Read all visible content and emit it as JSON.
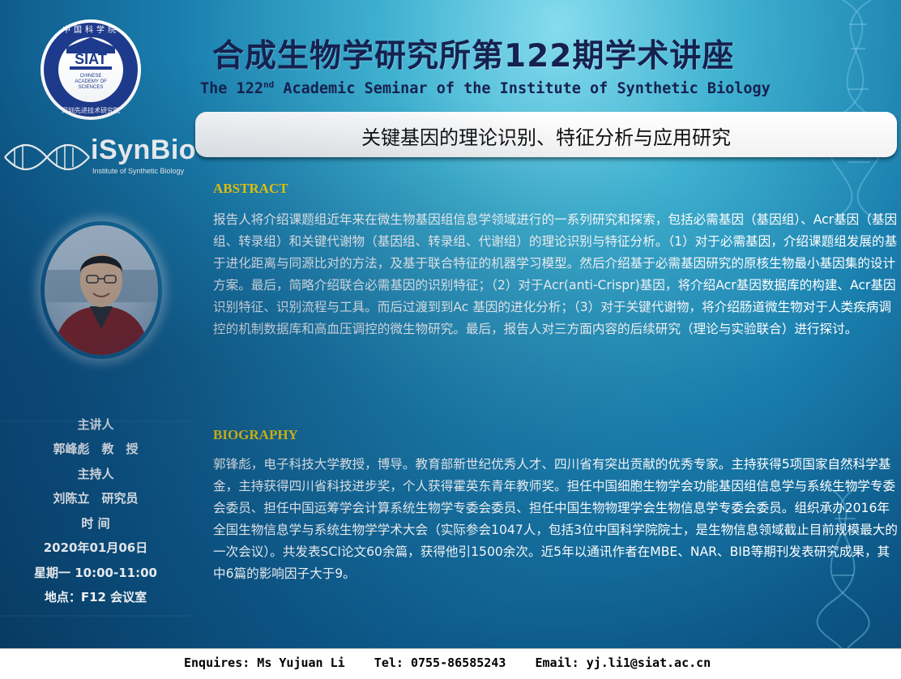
{
  "header": {
    "title_cn": "合成生物学研究所第122期学术讲座",
    "title_en_prefix": "The 122",
    "title_en_sup": "nd",
    "title_en_suffix": " Academic Seminar of the Institute of Synthetic Biology",
    "topic": "关键基因的理论识别、特征分析与应用研究"
  },
  "logos": {
    "siat_text": "SIAT",
    "siat_ring_top": "中国科学院",
    "siat_sub1": "CHINESE",
    "siat_sub2": "ACADEMY OF",
    "siat_sub3": "SCIENCES",
    "siat_ring_bottom": "深圳先进技术研究院",
    "isynbio_name": "iSynBio",
    "isynbio_sub": "Institute of Synthetic Biology"
  },
  "sidebar": {
    "speaker_label": "主讲人",
    "speaker_name": "郭峰彪　教　授",
    "host_label": "主持人",
    "host_name": "刘陈立　研究员",
    "time_label": "时  间",
    "date": "2020年01月06日",
    "time": "星期一 10:00-11:00",
    "location": "地点：F12 会议室"
  },
  "abstract": {
    "heading": "ABSTRACT",
    "text": "报告人将介绍课题组近年来在微生物基因组信息学领域进行的一系列研究和探索，包括必需基因（基因组）、Acr基因（基因组、转录组）和关键代谢物（基因组、转录组、代谢组）的理论识别与特征分析。（1）对于必需基因，介绍课题组发展的基于进化距离与同源比对的方法，及基于联合特征的机器学习模型。然后介绍基于必需基因研究的原核生物最小基因集的设计方案。最后，简略介绍联合必需基因的识别特征；（2）对于Acr(anti-Crispr)基因，将介绍Acr基因数据库的构建、Acr基因识别特征、识别流程与工具。而后过渡到到Ac 基因的进化分析；（3）对于关键代谢物，将介绍肠道微生物对于人类疾病调控的机制数据库和高血压调控的微生物研究。最后，报告人对三方面内容的后续研究（理论与实验联合）进行探讨。"
  },
  "biography": {
    "heading": "BIOGRAPHY",
    "text": "郭锋彪，电子科技大学教授，博导。教育部新世纪优秀人才、四川省有突出贡献的优秀专家。主持获得5项国家自然科学基金，主持获得四川省科技进步奖，个人获得霍英东青年教师奖。担任中国细胞生物学会功能基因组信息学与系统生物学专委会委员、担任中国运筹学会计算系统生物学专委会委员、担任中国生物物理学会生物信息学专委会委员。组织承办2016年全国生物信息学与系统生物学学术大会（实际参会1047人，包括3位中国科学院院士，是生物信息领域截止目前规模最大的一次会议）。共发表SCI论文60余篇，获得他引1500余次。近5年以通讯作者在MBE、NAR、BIB等期刊发表研究成果，其中6篇的影响因子大于9。"
  },
  "footer": {
    "text": "Enquires: Ms Yujuan Li    Tel: 0755-86585243    Email: yj.li1@siat.ac.cn"
  },
  "colors": {
    "title": "#16214f",
    "heading": "#ffd700",
    "body": "#ffffff",
    "bg_light": "#86dcee",
    "bg_dark": "#083a62"
  }
}
